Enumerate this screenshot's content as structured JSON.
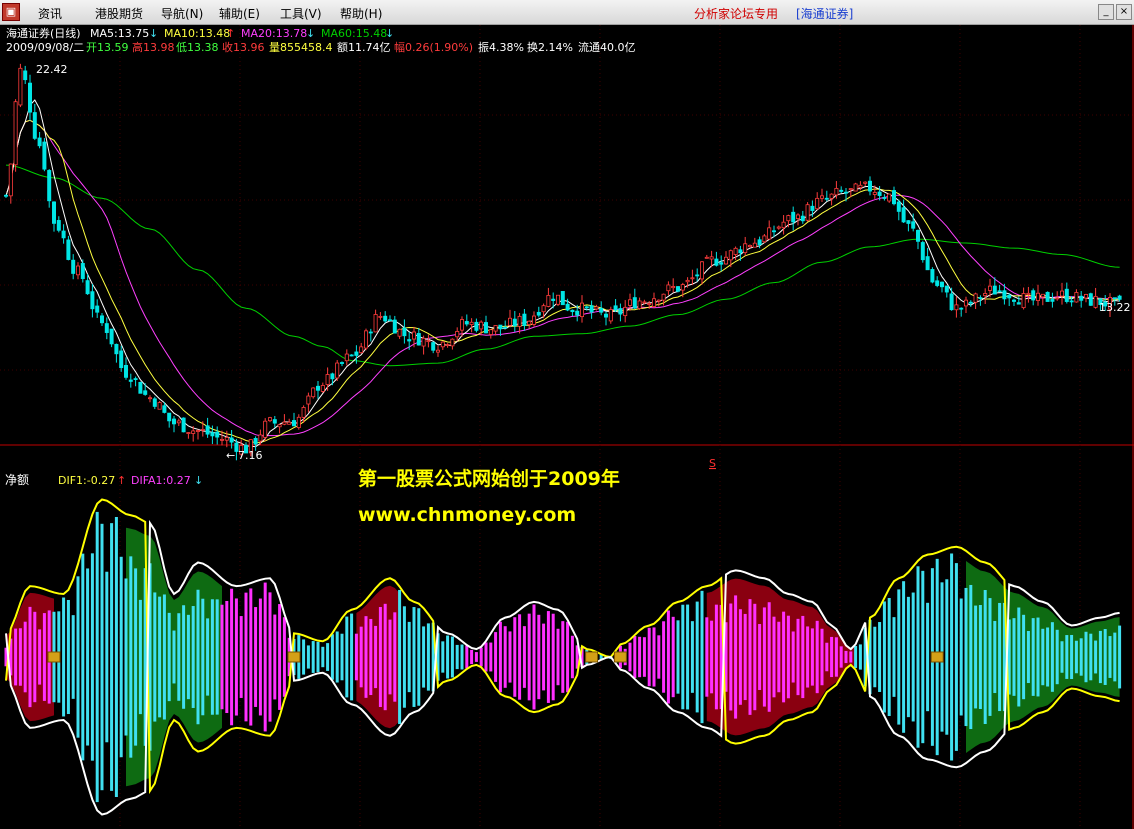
{
  "menu": {
    "items": [
      "资讯",
      "港股期货",
      "导航(N)",
      "辅助(E)",
      "工具(V)",
      "帮助(H)"
    ],
    "promo_text": "分析家论坛专用",
    "broker_text": "[海通证券]"
  },
  "header": {
    "title": "海通证券(日线)",
    "ma5": "MA5:13.75",
    "ma10": "MA10:13.48",
    "ma20": "MA20:13.78",
    "ma60": "MA60:15.48",
    "date": "2009/09/08/二",
    "open": "开13.59",
    "high": "高13.98",
    "low": "低13.38",
    "close": "收13.96",
    "volume": "量855458.4",
    "amount": "额11.74亿",
    "change": "幅0.26(1.90%)",
    "amplitude": "振4.38%",
    "turnover": "换2.14%",
    "float": "流通40.0亿"
  },
  "indicator": {
    "name": "净额",
    "dif1": "DIF1:-0.27",
    "difa1": "DIFA1:0.27"
  },
  "watermark": {
    "line1": "第一股票公式网始创于2009年",
    "line2": "www.chnmoney.com"
  },
  "annotations": {
    "max_price": "22.42",
    "min_price": "7.16",
    "last_price": "13.22",
    "marker": "S"
  },
  "colors": {
    "up": "#ff3c3c",
    "down": "#00e5e5",
    "ma5": "#ffffff",
    "ma10": "#ffff40",
    "ma20": "#ff40ff",
    "ma60": "#00d000",
    "hist_cyan": "#40e0f0",
    "hist_magenta": "#ff30ff",
    "band_green": "#0e6b12",
    "band_red": "#8a0010",
    "line_yellow": "#ffff00",
    "line_white": "#ffffff",
    "grid": "#c00000"
  },
  "chart_data": {
    "type": "candlestick",
    "price_range": [
      7.16,
      22.42
    ],
    "price_anchors": [
      [
        0,
        17.5
      ],
      [
        3,
        22.4
      ],
      [
        7,
        19.5
      ],
      [
        10,
        16.5
      ],
      [
        15,
        14.5
      ],
      [
        20,
        12.5
      ],
      [
        25,
        10.6
      ],
      [
        30,
        9.6
      ],
      [
        35,
        8.6
      ],
      [
        40,
        8.3
      ],
      [
        45,
        8.0
      ],
      [
        50,
        7.6
      ],
      [
        55,
        8.6
      ],
      [
        60,
        8.7
      ],
      [
        66,
        10.2
      ],
      [
        72,
        11.2
      ],
      [
        78,
        12.8
      ],
      [
        84,
        12.0
      ],
      [
        90,
        11.7
      ],
      [
        96,
        12.5
      ],
      [
        102,
        12.3
      ],
      [
        108,
        12.6
      ],
      [
        114,
        13.6
      ],
      [
        118,
        13.1
      ],
      [
        126,
        12.8
      ],
      [
        132,
        13.4
      ],
      [
        140,
        13.9
      ],
      [
        148,
        15.0
      ],
      [
        156,
        15.7
      ],
      [
        164,
        16.6
      ],
      [
        170,
        17.3
      ],
      [
        174,
        17.6
      ],
      [
        180,
        17.8
      ],
      [
        184,
        17.5
      ],
      [
        188,
        16.3
      ],
      [
        194,
        14.0
      ],
      [
        198,
        13.1
      ],
      [
        206,
        13.8
      ],
      [
        214,
        13.4
      ],
      [
        220,
        13.6
      ],
      [
        226,
        13.4
      ],
      [
        232,
        13.22
      ]
    ],
    "ma60_anchors": [
      [
        0,
        18.7
      ],
      [
        10,
        18.2
      ],
      [
        20,
        17.4
      ],
      [
        30,
        16.2
      ],
      [
        40,
        14.6
      ],
      [
        50,
        13.1
      ],
      [
        60,
        12.0
      ],
      [
        66,
        11.6
      ],
      [
        72,
        11.05
      ],
      [
        80,
        10.85
      ],
      [
        90,
        10.95
      ],
      [
        100,
        11.5
      ],
      [
        110,
        12.0
      ],
      [
        120,
        12.1
      ],
      [
        130,
        12.4
      ],
      [
        140,
        12.85
      ],
      [
        150,
        13.45
      ],
      [
        160,
        14.1
      ],
      [
        170,
        14.9
      ],
      [
        180,
        15.5
      ],
      [
        190,
        15.8
      ],
      [
        200,
        15.65
      ],
      [
        210,
        15.45
      ],
      [
        220,
        15.2
      ],
      [
        232,
        14.7
      ]
    ],
    "envelope_anchors": [
      [
        0,
        0.15
      ],
      [
        5,
        0.45
      ],
      [
        12,
        0.4
      ],
      [
        20,
        1.0
      ],
      [
        26,
        0.9
      ],
      [
        30,
        0.85
      ],
      [
        35,
        0.4
      ],
      [
        40,
        0.6
      ],
      [
        48,
        0.45
      ],
      [
        55,
        0.5
      ],
      [
        60,
        0.15
      ],
      [
        66,
        0.1
      ],
      [
        72,
        0.3
      ],
      [
        80,
        0.5
      ],
      [
        85,
        0.35
      ],
      [
        92,
        0.15
      ],
      [
        98,
        0.05
      ],
      [
        104,
        0.25
      ],
      [
        110,
        0.35
      ],
      [
        115,
        0.3
      ],
      [
        121,
        0.05
      ],
      [
        126,
        0.0
      ],
      [
        128,
        0.08
      ],
      [
        134,
        0.2
      ],
      [
        140,
        0.35
      ],
      [
        146,
        0.45
      ],
      [
        152,
        0.55
      ],
      [
        158,
        0.5
      ],
      [
        163,
        0.4
      ],
      [
        168,
        0.35
      ],
      [
        172,
        0.2
      ],
      [
        176,
        0.05
      ],
      [
        180,
        0.25
      ],
      [
        186,
        0.5
      ],
      [
        192,
        0.65
      ],
      [
        198,
        0.7
      ],
      [
        204,
        0.6
      ],
      [
        210,
        0.45
      ],
      [
        216,
        0.35
      ],
      [
        222,
        0.2
      ],
      [
        228,
        0.25
      ],
      [
        232,
        0.28
      ]
    ],
    "color_breaks": [
      [
        0,
        "r"
      ],
      [
        10,
        "c"
      ],
      [
        25,
        "g"
      ],
      [
        45,
        "m"
      ],
      [
        60,
        "c"
      ],
      [
        73,
        "r"
      ],
      [
        82,
        "c"
      ],
      [
        96,
        "m"
      ],
      [
        121,
        "c"
      ],
      [
        128,
        "m"
      ],
      [
        140,
        "c"
      ],
      [
        146,
        "r"
      ],
      [
        177,
        "c"
      ],
      [
        200,
        "g"
      ]
    ]
  }
}
